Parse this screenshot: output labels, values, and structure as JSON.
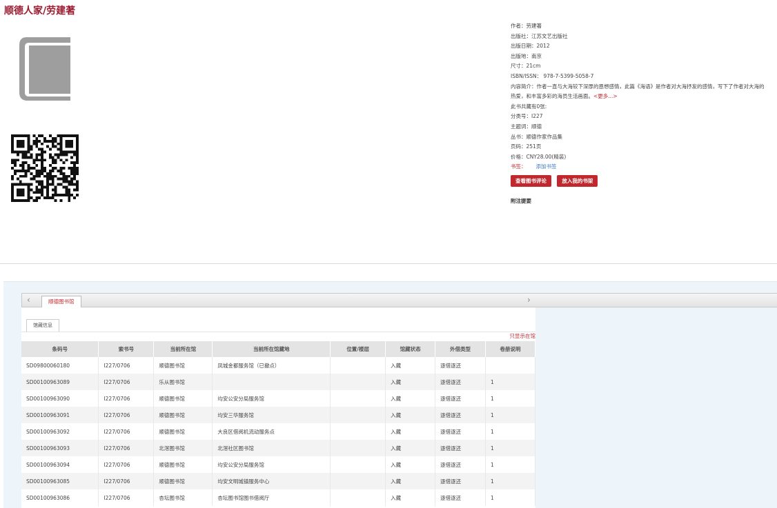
{
  "page": {
    "title": "顺德人家/劳建著"
  },
  "book_info": {
    "author": "作者：劳建著",
    "publisher": "出版社：江苏文艺出版社",
    "pub_date": "出版日期：2012",
    "pub_place": "出版地：南京",
    "size": "尺寸：21cm",
    "isbn": "ISBN/ISSN： 978-7-5399-5058-7",
    "summary": "内容简介：作者一直与大海较下深厚的恩想感情，此篇《海语》是作者对大海抒发的感情，写下了作者对大海的热爱，和丰富多彩的海员生活画面。",
    "more": "<更多...>",
    "copies": "此书共藏有0张:",
    "class_no": "分类号：I227",
    "keywords": "主题词：顺德",
    "series": "丛书：顺德作家作品集",
    "pages": "页码：251页",
    "price": "价格：CNY28.00(精装)",
    "bookmark_label": "书签：",
    "bookmark_link": "添加书签",
    "review_button": "查看图书评论",
    "shelf_button": "放入我的书架",
    "attachment": "附注提要"
  },
  "holdings": {
    "library_tab": "顺德图书馆",
    "subtab": "馆藏信息",
    "only_this_lib": "只显示在馆",
    "columns": [
      "条码号",
      "索书号",
      "当前所在馆",
      "当前所在馆藏地",
      "位置/楼层",
      "馆藏状态",
      "外借类型",
      "卷册说明"
    ],
    "rows": [
      [
        "SD09800060180",
        "I227/0706",
        "顺德图书馆",
        "凤城金都服务馆（已撤点）",
        "",
        "入藏",
        "逐借逐还",
        ""
      ],
      [
        "SD00100963089",
        "I227/0706",
        "乐从图书馆",
        "",
        "",
        "入藏",
        "逐借逐还",
        "1"
      ],
      [
        "SD00100963090",
        "I227/0706",
        "顺德图书馆",
        "均安公安分局服务馆",
        "",
        "入藏",
        "逐借逐还",
        "1"
      ],
      [
        "SD00100963091",
        "I227/0706",
        "顺德图书馆",
        "均安三华服务馆",
        "",
        "入藏",
        "逐借逐还",
        "1"
      ],
      [
        "SD00100963092",
        "I227/0706",
        "顺德图书馆",
        "大良区借阅机流动服务点",
        "",
        "入藏",
        "逐借逐还",
        "1"
      ],
      [
        "SD00100963093",
        "I227/0706",
        "北滘图书馆",
        "北滘社区图书馆",
        "",
        "入藏",
        "逐借逐还",
        "1"
      ],
      [
        "SD00100963094",
        "I227/0706",
        "顺德图书馆",
        "均安公安分局服务馆",
        "",
        "入藏",
        "逐借逐还",
        "1"
      ],
      [
        "SD00100963085",
        "I227/0706",
        "顺德图书馆",
        "均安文明城镇服务中心",
        "",
        "入藏",
        "逐借逐还",
        "1"
      ],
      [
        "SD00100963086",
        "I227/0706",
        "杏坛图书馆",
        "杏坛图书馆图书借阅厅",
        "",
        "入藏",
        "逐借逐还",
        "1"
      ]
    ]
  },
  "icons": {
    "cover": "book-cover-icon",
    "qr": "qr-code-icon",
    "prev": "chevron-left-icon",
    "next": "chevron-right-icon"
  },
  "colors": {
    "accent": "#c0282d",
    "title": "#9b1b30",
    "link": "#3a78c3"
  }
}
